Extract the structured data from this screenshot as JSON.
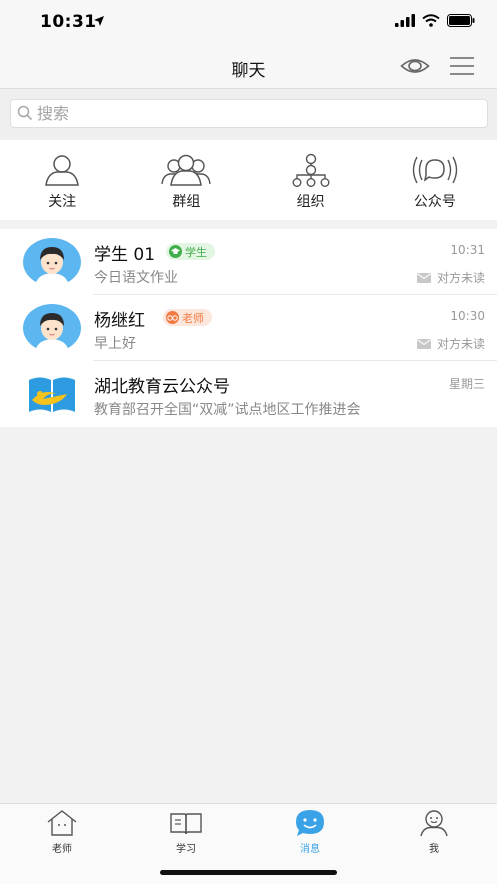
{
  "status": {
    "time": "10:31"
  },
  "nav": {
    "title": "聊天"
  },
  "search": {
    "placeholder": "搜索"
  },
  "quick_actions": [
    {
      "label": "关注",
      "icon": "person-icon"
    },
    {
      "label": "群组",
      "icon": "group-icon"
    },
    {
      "label": "组织",
      "icon": "org-tree-icon"
    },
    {
      "label": "公众号",
      "icon": "broadcast-icon"
    }
  ],
  "chats": [
    {
      "name": "学生 01",
      "badge": "学生",
      "message": "今日语文作业",
      "time": "10:31",
      "status": "对方未读"
    },
    {
      "name": "杨继红",
      "badge": "老师",
      "message": "早上好",
      "time": "10:30",
      "status": "对方未读"
    },
    {
      "name": "湖北教育云公众号",
      "message": "教育部召开全国“双减”试点地区工作推进会",
      "time": "星期三"
    }
  ],
  "tabs": [
    {
      "label": "老师"
    },
    {
      "label": "学习"
    },
    {
      "label": "消息"
    },
    {
      "label": "我"
    }
  ],
  "colors": {
    "accent": "#3aa3e8",
    "student_badge": "#3fae4a",
    "teacher_badge": "#f07a40"
  }
}
